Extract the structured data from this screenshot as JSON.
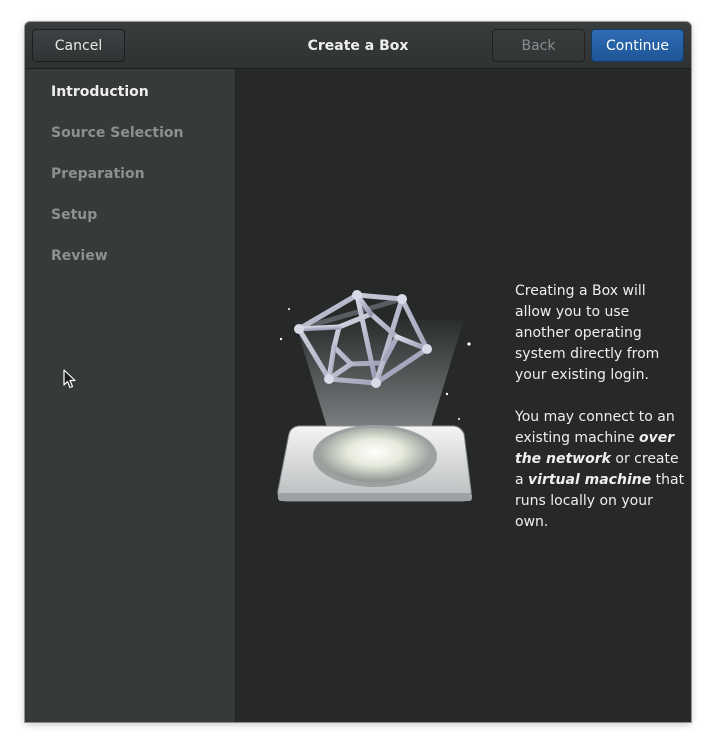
{
  "header": {
    "title": "Create a Box",
    "cancel_label": "Cancel",
    "back_label": "Back",
    "continue_label": "Continue"
  },
  "sidebar": {
    "items": [
      {
        "label": "Introduction",
        "active": true
      },
      {
        "label": "Source Selection",
        "active": false
      },
      {
        "label": "Preparation",
        "active": false
      },
      {
        "label": "Setup",
        "active": false
      },
      {
        "label": "Review",
        "active": false
      }
    ]
  },
  "intro": {
    "paragraph1": "Creating a Box will allow you to use another operating system directly from your existing login.",
    "p2_part1": "You may connect to an existing machine ",
    "p2_em1": "over the network",
    "p2_part2": " or create a ",
    "p2_em2": "virtual machine",
    "p2_part3": " that runs locally on your own."
  },
  "illustration": {
    "icon": "tesseract-projector-icon"
  },
  "colors": {
    "accent": "#1e5596",
    "sidebar_bg": "#363a3a",
    "content_bg": "#272929",
    "header_bg": "#353839"
  }
}
